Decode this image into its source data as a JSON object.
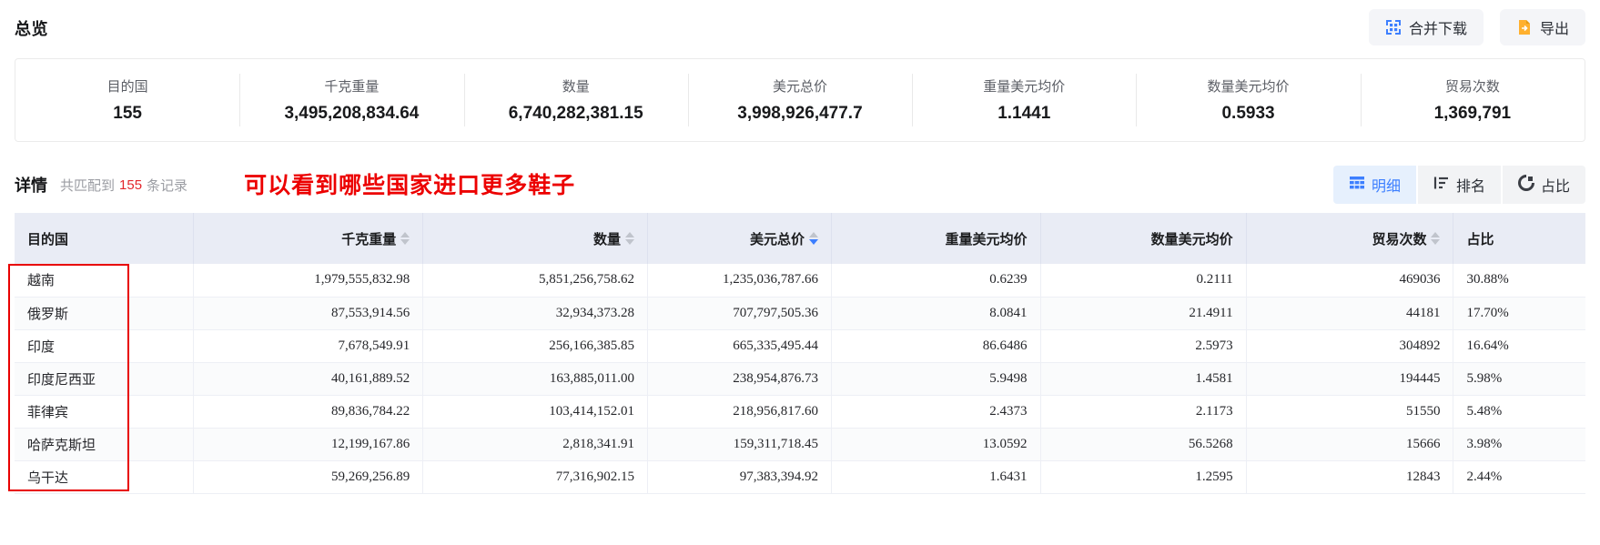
{
  "overview": {
    "title": "总览",
    "stats": [
      {
        "label": "目的国",
        "value": "155"
      },
      {
        "label": "千克重量",
        "value": "3,495,208,834.64"
      },
      {
        "label": "数量",
        "value": "6,740,282,381.15"
      },
      {
        "label": "美元总价",
        "value": "3,998,926,477.7"
      },
      {
        "label": "重量美元均价",
        "value": "1.1441"
      },
      {
        "label": "数量美元均价",
        "value": "0.5933"
      },
      {
        "label": "贸易次数",
        "value": "1,369,791"
      }
    ],
    "actions": [
      {
        "label": "合并下载",
        "icon": "merge-download-icon",
        "icon_color": "#3d7fff"
      },
      {
        "label": "导出",
        "icon": "export-icon",
        "icon_color": "#ffb02e"
      }
    ]
  },
  "details": {
    "title": "详情",
    "match_prefix": "共匹配到",
    "match_count": "155",
    "match_suffix": "条记录",
    "annotation": "可以看到哪些国家进口更多鞋子",
    "views": [
      {
        "label": "明细",
        "icon": "table-icon",
        "active": true
      },
      {
        "label": "排名",
        "icon": "ranking-icon",
        "active": false
      },
      {
        "label": "占比",
        "icon": "pie-icon",
        "active": false
      }
    ]
  },
  "table": {
    "columns": [
      {
        "label": "目的国",
        "align": "left",
        "sortable": false,
        "sort": null
      },
      {
        "label": "千克重量",
        "align": "right",
        "sortable": true,
        "sort": null
      },
      {
        "label": "数量",
        "align": "right",
        "sortable": true,
        "sort": null
      },
      {
        "label": "美元总价",
        "align": "right",
        "sortable": true,
        "sort": "desc"
      },
      {
        "label": "重量美元均价",
        "align": "right",
        "sortable": false,
        "sort": null
      },
      {
        "label": "数量美元均价",
        "align": "right",
        "sortable": false,
        "sort": null
      },
      {
        "label": "贸易次数",
        "align": "right",
        "sortable": true,
        "sort": null
      },
      {
        "label": "占比",
        "align": "left",
        "sortable": false,
        "sort": null
      }
    ],
    "rows": [
      [
        "越南",
        "1,979,555,832.98",
        "5,851,256,758.62",
        "1,235,036,787.66",
        "0.6239",
        "0.2111",
        "469036",
        "30.88%"
      ],
      [
        "俄罗斯",
        "87,553,914.56",
        "32,934,373.28",
        "707,797,505.36",
        "8.0841",
        "21.4911",
        "44181",
        "17.70%"
      ],
      [
        "印度",
        "7,678,549.91",
        "256,166,385.85",
        "665,335,495.44",
        "86.6486",
        "2.5973",
        "304892",
        "16.64%"
      ],
      [
        "印度尼西亚",
        "40,161,889.52",
        "163,885,011.00",
        "238,954,876.73",
        "5.9498",
        "1.4581",
        "194445",
        "5.98%"
      ],
      [
        "菲律宾",
        "89,836,784.22",
        "103,414,152.01",
        "218,956,817.60",
        "2.4373",
        "2.1173",
        "51550",
        "5.48%"
      ],
      [
        "哈萨克斯坦",
        "12,199,167.86",
        "2,818,341.91",
        "159,311,718.45",
        "13.0592",
        "56.5268",
        "15666",
        "3.98%"
      ],
      [
        "乌干达",
        "59,269,256.89",
        "77,316,902.15",
        "97,383,394.92",
        "1.6431",
        "1.2595",
        "12843",
        "2.44%"
      ]
    ]
  },
  "colors": {
    "accent_blue": "#3d7fff",
    "export_orange": "#ffb02e",
    "annotation_red": "#ec0000",
    "count_red": "#e3262b",
    "header_bg": "#e9ecf5"
  }
}
